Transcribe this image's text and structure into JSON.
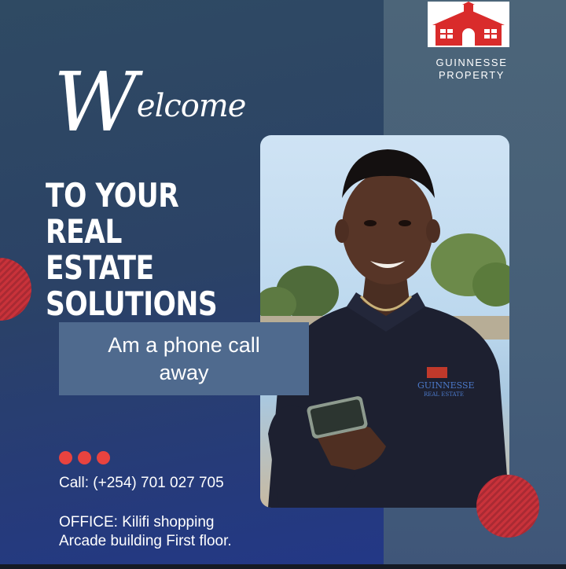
{
  "brand": {
    "name_line1": "GUINNESSE",
    "name_line2": "PROPERTY",
    "logo_icon": "house-logo-icon",
    "logo_color": "#d92b2b"
  },
  "welcome": {
    "capital": "W",
    "rest": "elcome"
  },
  "headline": {
    "line1": "TO YOUR REAL",
    "line2": "ESTATE",
    "line3": "SOLUTIONS"
  },
  "call_box": {
    "line1": "Am a phone call",
    "line2": "away"
  },
  "contact": {
    "phone": "Call: (+254) 701 027 705",
    "office_line1": "OFFICE: Kilifi shopping",
    "office_line2": "Arcade building First floor."
  },
  "shirt_logo": {
    "line1": "GUINNESSE",
    "line2": "REAL ESTATE"
  },
  "colors": {
    "accent_red": "#e8433f",
    "call_box_bg": "#4f6a8e",
    "panel_bg": "#4c6579"
  }
}
